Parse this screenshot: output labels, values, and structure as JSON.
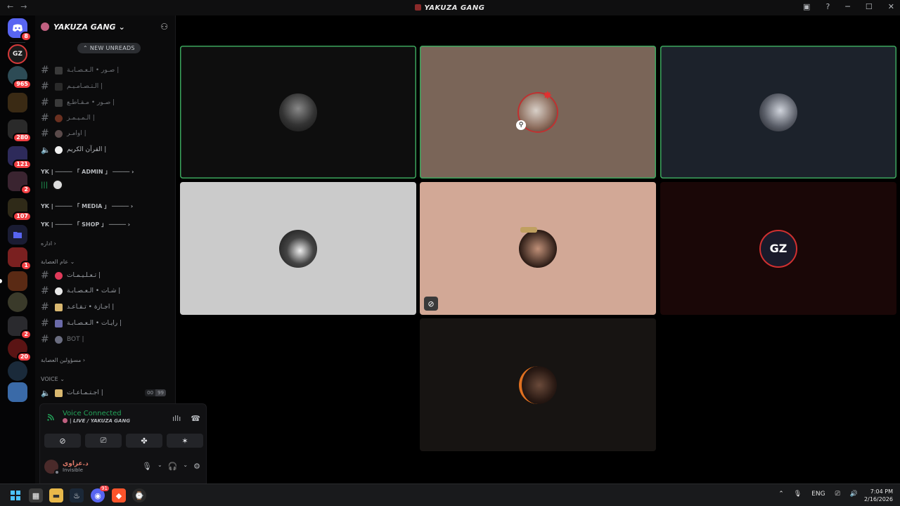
{
  "window": {
    "title": "YAKUZA GANG",
    "back_icon": "←",
    "forward_icon": "→",
    "controls": [
      "inbox-icon",
      "help-icon",
      "minimize",
      "maximize",
      "close"
    ]
  },
  "guild_bar": {
    "home_badge": "8",
    "servers": [
      {
        "name": "GZ",
        "badge": ""
      },
      {
        "name": "",
        "badge": "965"
      },
      {
        "name": "",
        "badge": ""
      },
      {
        "name": "",
        "badge": "280"
      },
      {
        "name": "",
        "badge": "121"
      },
      {
        "name": "",
        "badge": "2"
      },
      {
        "name": "",
        "badge": "107"
      },
      {
        "name": "folder",
        "badge": ""
      },
      {
        "name": "",
        "badge": "1"
      },
      {
        "name": "",
        "badge": ""
      },
      {
        "name": "",
        "badge": ""
      },
      {
        "name": "",
        "badge": "2"
      },
      {
        "name": "",
        "badge": "20"
      },
      {
        "name": "",
        "badge": ""
      },
      {
        "name": "",
        "badge": ""
      }
    ]
  },
  "server": {
    "name": "YAKUZA GANG",
    "new_unreads": "NEW UNREADS",
    "channels_top": [
      {
        "name": "صـور • الـعـصـابـة |"
      },
      {
        "name": "الـتـصـامـيـم |"
      },
      {
        "name": "صـور • مـقـاطـع |"
      },
      {
        "name": "الـمـيـمـز |"
      },
      {
        "name": "اوامـر |"
      },
      {
        "name": "القرآن الكريم |"
      }
    ],
    "categories": {
      "admin": "YK | ───── 「 ADMIN 」 ─────",
      "media": "YK | ───── 「 MEDIA 」 ─────",
      "shop": "YK | ───── 「 SHOP 」 ─────",
      "idara": "اداره",
      "gang_general": "عام العصابة",
      "gang_leaders": "مسؤولين العصابة",
      "voice": "VOICE"
    },
    "gang_channels": [
      {
        "name": "تـعـلـيـمـات |"
      },
      {
        "name": "شـات • الـعـصـابـة |"
      },
      {
        "name": "اجـازة • تـقـاعـد |"
      },
      {
        "name": "رايـات • الـعـصـابـة |"
      },
      {
        "name": "BOT |"
      }
    ],
    "voice_channel": {
      "name": "اجـتـمـاعـات |",
      "count_left": "00",
      "count_right": "99"
    }
  },
  "voice_panel": {
    "status": "Voice Connected",
    "channel": "| LIVE / YAKUZA GANG",
    "buttons": [
      "camera-off",
      "screen-share",
      "activities",
      "soundboard"
    ]
  },
  "user": {
    "name": "د.عزاوي",
    "status": "Invisible"
  },
  "call_tiles": [
    {
      "bg": "#0e0e0e",
      "speaking": true
    },
    {
      "bg": "#7a6558",
      "speaking": true
    },
    {
      "bg": "#1c222b",
      "speaking": true
    },
    {
      "bg": "#cbcbcb",
      "speaking": false
    },
    {
      "bg": "#d2a896",
      "speaking": false
    },
    {
      "bg": "#1a0707",
      "speaking": false
    },
    {
      "bg": "#171412",
      "speaking": false
    }
  ],
  "taskbar": {
    "discord_badge": "91",
    "language": "ENG",
    "time": "7:04 PM",
    "date": "2/16/2026"
  }
}
